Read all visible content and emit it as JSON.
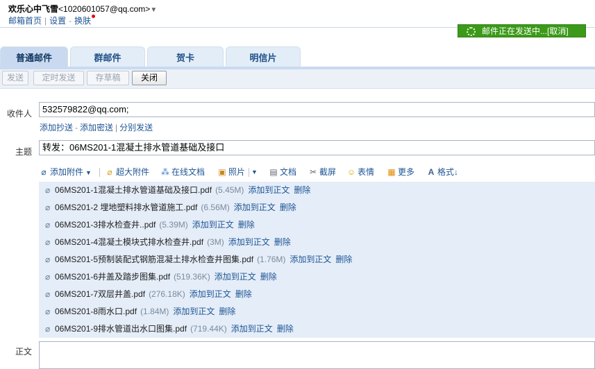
{
  "user": {
    "name": "欢乐心中飞雪",
    "email": "<1020601057@qq.com>"
  },
  "top_links": {
    "mailbox_home": "邮箱首页",
    "settings": "设置",
    "skin": "换肤"
  },
  "sending_status": {
    "text": "邮件正在发送中...",
    "cancel": "[取消]"
  },
  "tabs": [
    {
      "label": "普通邮件",
      "active": true
    },
    {
      "label": "群邮件",
      "active": false
    },
    {
      "label": "贺卡",
      "active": false
    },
    {
      "label": "明信片",
      "active": false
    }
  ],
  "toolbar": {
    "send": "发送",
    "scheduled_send": "定时发送",
    "save_draft": "存草稿",
    "close": "关闭"
  },
  "recipient": {
    "label": "收件人",
    "value": "532579822@qq.com;"
  },
  "recipient_links": {
    "add_cc": "添加抄送",
    "add_bcc": "添加密送",
    "separate_send": "分别发送"
  },
  "subject": {
    "label": "主题",
    "value": "转发：06MS201-1混凝土排水管道基础及接口"
  },
  "attach_toolbar": {
    "add_attachment": "添加附件",
    "large_attachment": "超大附件",
    "online_doc": "在线文档",
    "photo": "照片",
    "document": "文档",
    "screenshot": "截屏",
    "emoji": "表情",
    "more": "更多",
    "format": "格式↓"
  },
  "attachment_actions": {
    "add_to_body": "添加到正文",
    "delete": "删除"
  },
  "attachments": [
    {
      "name": "06MS201-1混凝土排水管道基础及接口.pdf",
      "size": "(5.45M)"
    },
    {
      "name": "06MS201-2 埋地塑料排水管道施工.pdf",
      "size": "(6.56M)"
    },
    {
      "name": "06MS201-3排水检查井..pdf",
      "size": "(5.39M)"
    },
    {
      "name": "06MS201-4混凝土模块式排水检查井.pdf",
      "size": "(3M)"
    },
    {
      "name": "06MS201-5预制装配式钢筋混凝土排水检查井图集.pdf",
      "size": "(1.76M)"
    },
    {
      "name": "06MS201-6井盖及踏步图集.pdf",
      "size": "(519.36K)"
    },
    {
      "name": "06MS201-7双层井盖.pdf",
      "size": "(276.18K)"
    },
    {
      "name": "06MS201-8雨水口.pdf",
      "size": "(1.84M)"
    },
    {
      "name": "06MS201-9排水管道出水口图集.pdf",
      "size": "(719.44K)"
    }
  ],
  "body_label": "正文",
  "colors": {
    "sending_bg": "#3b9a19",
    "link": "#1e5494",
    "tab_bg": "#e3edf8",
    "attachment_bg": "#e4edf8"
  }
}
